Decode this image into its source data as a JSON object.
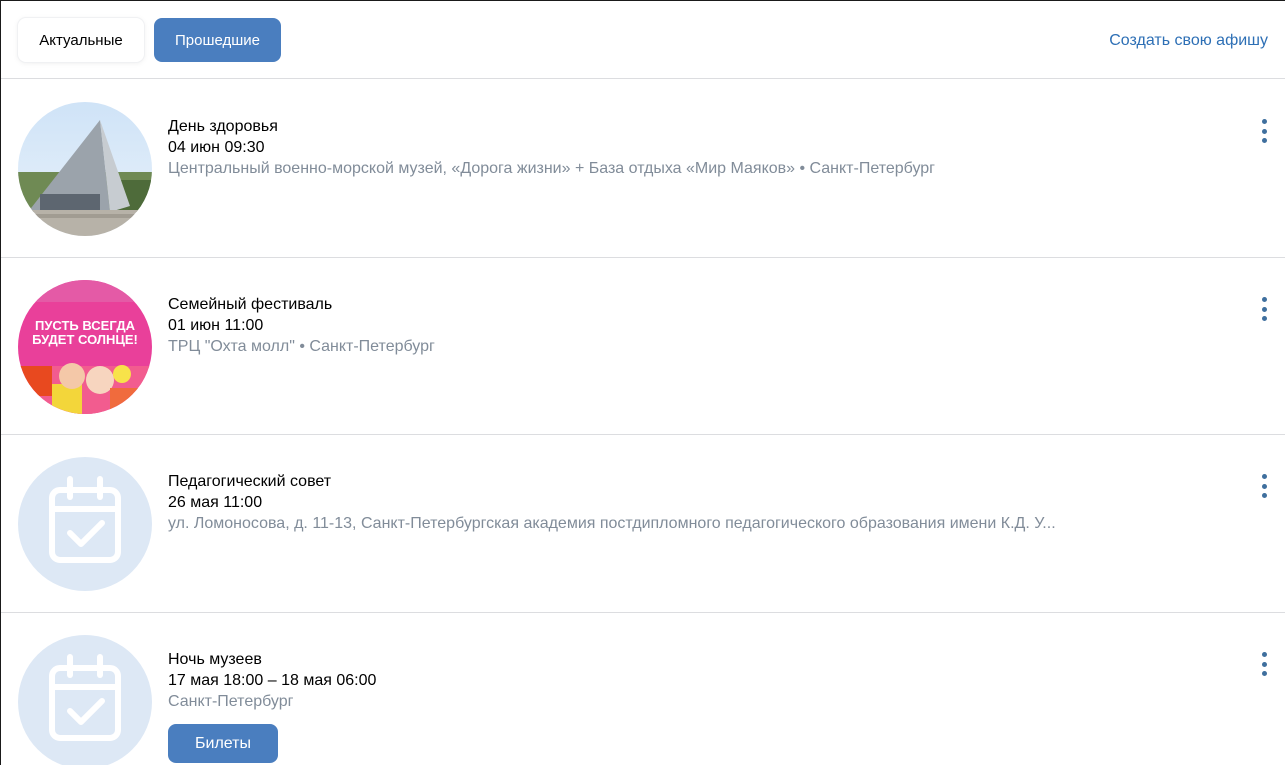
{
  "tabs": {
    "actual": "Актуальные",
    "past": "Прошедшие"
  },
  "create_link": "Создать свою афишу",
  "events": [
    {
      "title": "День здоровья",
      "date": "04 июн 09:30",
      "place": "Центральный военно-морской музей, «Дорога жизни» + База отдыха «Мир Маяков» • Санкт-Петербург"
    },
    {
      "title": "Семейный фестиваль",
      "date": "01 июн 11:00",
      "place": "ТРЦ \"Охта молл\" • Санкт-Петербург",
      "poster_text": [
        "ПУСТЬ ВСЕГДА",
        "БУДЕТ СОЛНЦЕ!"
      ]
    },
    {
      "title": "Педагогический совет",
      "date": "26 мая 11:00",
      "place": "ул. Ломоносова, д. 11-13, Санкт-Петербургская академия постдипломного педагогического образования имени К.Д. У..."
    },
    {
      "title": "Ночь музеев",
      "date": "17 мая 18:00 – 18 мая 06:00",
      "place": "Санкт-Петербург",
      "tickets_label": "Билеты"
    }
  ],
  "colors": {
    "accent": "#4a7ebf",
    "link": "#2d6fb5",
    "secondary_text": "#818c99",
    "divider": "#dcdde0",
    "placeholder_bg": "#dde8f5"
  }
}
